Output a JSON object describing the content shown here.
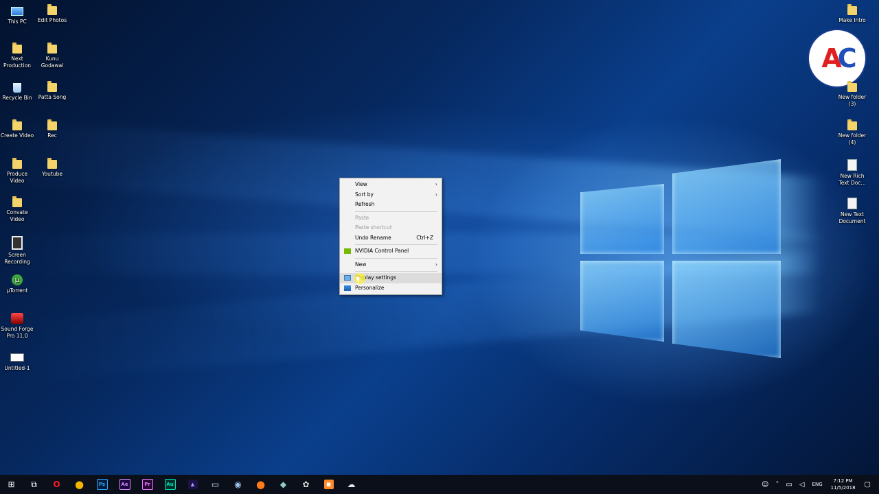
{
  "desktop": {
    "left_col1": [
      {
        "label": "This PC",
        "icon": "this-pc-icon"
      },
      {
        "label": "Next Production",
        "icon": "folder-icon"
      },
      {
        "label": "Recycle Bin",
        "icon": "recycle-bin-icon"
      },
      {
        "label": "Create Video",
        "icon": "folder-icon"
      },
      {
        "label": "Produce Video",
        "icon": "folder-icon"
      },
      {
        "label": "Convate Video",
        "icon": "folder-icon"
      },
      {
        "label": "Screen Recording",
        "icon": "film-icon"
      },
      {
        "label": "µTorrent",
        "icon": "utorrent-icon"
      },
      {
        "label": "Sound Forge Pro 11.0",
        "icon": "sound-forge-icon"
      },
      {
        "label": "Untitled-1",
        "icon": "file-icon"
      }
    ],
    "left_col2": [
      {
        "label": "Edit Photos",
        "icon": "folder-icon"
      },
      {
        "label": "Kunu Godawal",
        "icon": "folder-icon"
      },
      {
        "label": "Patta Song",
        "icon": "folder-icon"
      },
      {
        "label": "Rec",
        "icon": "folder-icon"
      },
      {
        "label": "Youtube",
        "icon": "folder-icon"
      }
    ],
    "right_col": [
      {
        "label": "Make Intro",
        "icon": "folder-icon"
      },
      {
        "label": "New folder (3)",
        "icon": "folder-icon"
      },
      {
        "label": "New folder (4)",
        "icon": "folder-icon"
      },
      {
        "label": "New Rich Text Doc...",
        "icon": "document-icon"
      },
      {
        "label": "New Text Document",
        "icon": "document-icon"
      }
    ],
    "logo": {
      "a": "A",
      "c": "C"
    }
  },
  "context_menu": {
    "view": "View",
    "sort_by": "Sort by",
    "refresh": "Refresh",
    "paste": "Paste",
    "paste_shortcut": "Paste shortcut",
    "undo_rename": "Undo Rename",
    "undo_shortcut": "Ctrl+Z",
    "nvidia": "NVIDIA Control Panel",
    "new": "New",
    "display_settings": "Display settings",
    "personalize": "Personalize",
    "arrow": "›"
  },
  "taskbar": {
    "apps": [
      {
        "name": "start-button",
        "glyph": "⊞"
      },
      {
        "name": "task-view-button",
        "glyph": "⧉"
      },
      {
        "name": "opera-icon",
        "glyph": "O"
      },
      {
        "name": "chrome-icon",
        "glyph": "●"
      },
      {
        "name": "photoshop-icon",
        "glyph": "Ps"
      },
      {
        "name": "after-effects-icon",
        "glyph": "Ae"
      },
      {
        "name": "premiere-icon",
        "glyph": "Pr"
      },
      {
        "name": "audition-icon",
        "glyph": "Au"
      },
      {
        "name": "media-encoder-icon",
        "glyph": "▲"
      },
      {
        "name": "file-explorer-icon",
        "glyph": "▭"
      },
      {
        "name": "steam-icon",
        "glyph": "◉"
      },
      {
        "name": "firefox-icon",
        "glyph": "●"
      },
      {
        "name": "app-icon",
        "glyph": "◆"
      },
      {
        "name": "app2-icon",
        "glyph": "✿"
      },
      {
        "name": "recorder-icon",
        "glyph": "■"
      },
      {
        "name": "cloud-app-icon",
        "glyph": "☁"
      }
    ],
    "language": "ENG",
    "time": "7:12 PM",
    "date": "11/5/2018"
  }
}
